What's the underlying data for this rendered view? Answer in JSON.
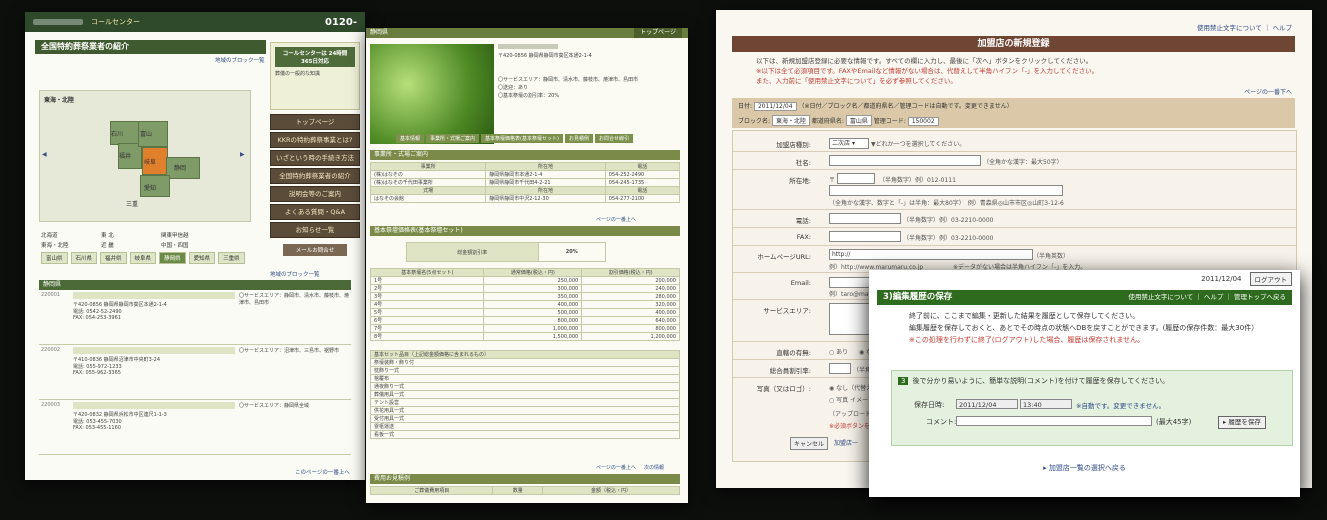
{
  "window_a": {
    "header": {
      "call_center_label": "コールセンター",
      "phone": "0120-"
    },
    "title": "全国特約葬祭業者の紹介",
    "block_link": "地域のブロック一覧",
    "map_label": "東海・北陸",
    "map_prefs": [
      "石川",
      "福井",
      "富山",
      "岐阜",
      "静岡",
      "愛知",
      "三重"
    ],
    "regions": [
      "北海道",
      "東 北",
      "関東甲信越",
      "東海・北陸",
      "近 畿",
      "中国・四国",
      "九 州",
      "沖 縄"
    ],
    "prefs": [
      "富山県",
      "石川県",
      "福井県",
      "岐阜県",
      "静岡県",
      "愛知県",
      "三重県"
    ],
    "selected_pref": "静岡県",
    "call_center_box": {
      "title": "コールセンターは\n24時間365日対応",
      "text": "葬儀の一般的な知識"
    },
    "nav": [
      "トップページ",
      "KKRの特約葬祭事業とは?",
      "いざという時の手続き方法",
      "全国特約葬祭業者の紹介",
      "説明会等のご案内",
      "よくある質問・Q&A",
      "お知らせ一覧"
    ],
    "mail": "メールお問合せ",
    "listing_title": "静岡県",
    "listing_link": "地域のブロック一覧",
    "rows": [
      {
        "id": "220001",
        "addr": "〒420-0856 静岡県静岡市葵区本通2-1-4",
        "tel": "電話: 0542-52-2490",
        "fax": "FAX: 054-253-3961",
        "area": "〇サービスエリア：静岡市、清水市、藤枝市、焼津市、島田市"
      },
      {
        "id": "220002",
        "addr": "〒410-0836 静岡県沼津市中央町3-24",
        "tel": "電話: 055-972-1233",
        "fax": "FAX: 055-962-3365",
        "area": "〇サービスエリア：沼津市、三島市、裾野市"
      },
      {
        "id": "220003",
        "addr": "〒420-0832 静岡県浜松市中区連尺1-1-3",
        "tel": "電話: 053-455-7030",
        "fax": "FAX: 053-455-1160",
        "area": "〇サービスエリア：静岡県全域"
      }
    ],
    "page_top": "このページの一番上へ"
  },
  "window_b": {
    "breadcrumb": "静岡県",
    "top_link": "トップページ",
    "info": [
      "〒420-0856 静岡県静岡市葵区本通2-1-4",
      "〇サービスエリア：静岡市、清水市、藤枝市、焼津市、島田市",
      "〇送迎：あり",
      "〇基本祭壇の割引率：20%"
    ],
    "tabs": [
      "基本情報",
      "事業所・式場ご案内",
      "基本祭壇価格表(基本祭壇セット)",
      "お見積例",
      "お問合せ線引"
    ],
    "section1": "事業所・式場ご案内",
    "table1_head": [
      "事業所",
      "所在地",
      "電話"
    ],
    "table1_rows": [
      [
        "(株)はなその",
        "静岡県静岡市本通2-1-4",
        "054-252-2490"
      ],
      [
        "(株)はなその千代田事業所",
        "静岡県静岡市千代田4-2-21",
        "054-245-1735"
      ]
    ],
    "table1_head2": [
      "式場",
      "所在地",
      "電話"
    ],
    "table1_rows2": [
      [
        "はなその会館",
        "静岡県静岡市中沢2-12-30",
        "054-277-2100"
      ]
    ],
    "section2": "基本祭壇価格表(基本祭壇セット)",
    "discount_label": "総金額割引率",
    "discount_value": "20%",
    "table2_head": [
      "基本祭壇名(5点セット)",
      "通常価格(税込・円)",
      "割引価格(税込・円)"
    ],
    "table2_rows": [
      [
        "1号",
        "250,000",
        "200,000"
      ],
      [
        "2号",
        "300,000",
        "240,000"
      ],
      [
        "3号",
        "350,000",
        "280,000"
      ],
      [
        "4号",
        "400,000",
        "320,000"
      ],
      [
        "5号",
        "500,000",
        "400,000"
      ],
      [
        "6号",
        "800,000",
        "640,000"
      ],
      [
        "7号",
        "1,000,000",
        "800,000"
      ],
      [
        "8号",
        "1,500,000",
        "1,200,000"
      ]
    ],
    "set_items_title": "基本セット品目（上記総金額価格に含まれるもの）",
    "set_items": [
      "祭壇装飾・飾り付",
      "枕飾り一式",
      "棺覆布",
      "通夜飾り一式",
      "葬儀用具一式",
      "テント設営",
      "供花用具一式",
      "受付用具一式",
      "霊柩運送",
      "看板一式"
    ],
    "page_top": "ページの一番上へ",
    "next": "次の情報",
    "section3": "費用お見積例",
    "table3_head": [
      "ご葬儀費用項目",
      "数量",
      "金額（税込・円）"
    ]
  },
  "window_c": {
    "links": [
      "使用禁止文字について",
      "ヘルプ"
    ],
    "title": "加盟店の新規登録",
    "intro": "以下は、新規加盟店登録に必要な情報です。すべての欄に入力し、最後に「次へ」ボタンをクリックしてください。",
    "intro_note": "※以下は全て必須項目です。FAXやEmailなど情報がない場合は、代替えして半角ハイフン「-」を入力してください。",
    "intro_note2": "また、入力前に「使用禁止文字について」を必ず参照してください。",
    "next_link": "ページの一番下へ",
    "date_label": "日付:",
    "date": "2011/12/04",
    "date_note": "（※日付／ブロック名／都道府県名／管理コードは自動です。変更できません）",
    "block_label": "ブロック名:",
    "block": "東海・北陸",
    "pref_label": "都道府県名:",
    "pref": "富山県",
    "code_label": "管理コード:",
    "code": "150002",
    "labels": [
      "加盟店種別:",
      "社名:",
      "所在地:",
      "電話:",
      "FAX:",
      "ホームページURL:",
      "Email:",
      "サービスエリア:",
      "直轄の有無:",
      "総合員割引率:",
      "写真（又はロゴ）:"
    ],
    "type_value": "二次店",
    "type_hint": "▼どれか一つを選択してください。",
    "company_hint": "（全角かな漢字：最大50字）",
    "zip_mark": "〒",
    "zip_hint": "（半角数字）例）012-0111",
    "addr_hint": "（全角かな漢字、数字と「-」は半角：最大80字）　例）青森県◎山市市区◎山町3-12-6",
    "tel_hint": "（半角数字）例）03-2210-0000",
    "fax_hint": "（半角数字）例）03-2210-0000",
    "url_value": "http://",
    "url_hint": "（半角英数）",
    "url_example": "例）http://www.marumaru.co.jp",
    "url_note": "※データがない場合は半角ハイフン「-」を入力。",
    "email_example": "例）taro@marumaru",
    "yesno": [
      "あり",
      "なし"
    ],
    "discount_hint": "（半角数字）",
    "photo_opts": [
      "なし（代替え イメージ",
      "写真 イメージを"
    ],
    "upload_hint": "（アップロードするイメ",
    "required_hint": "※必須ボタンをクリック",
    "cancel": "キャンセル",
    "back_link": "加盟店一"
  },
  "window_d": {
    "date": "2011/12/04",
    "logout": "ログアウト",
    "title": "3)編集履歴の保存",
    "nav": [
      "使用禁止文字について",
      "ヘルプ",
      "管理トップへ戻る"
    ],
    "line1": "終了前に、ここまで編集・更新した結果を履歴として保存してください。",
    "line2": "編集履歴を保存しておくと、あとでその時点の状態へDBを戻すことができます。(履歴の保存件数：最大30件）",
    "warn": "※この処理を行わずに終了(ログアウト)した場合、履歴は保存されません。",
    "step_num": "3",
    "step_text": "後で分かり易いように、簡単な説明(コメント)を付けて履歴を保存してください。",
    "save_label": "保存日時:",
    "save_date": "2011/12/04",
    "save_time": "13:40",
    "auto_note": "※自動です。変更できません。",
    "comment_label": "コメント:",
    "comment_limit": "(最大45字)",
    "save_button": "履歴を保存",
    "back_link": "加盟店一覧の選択へ戻る"
  }
}
